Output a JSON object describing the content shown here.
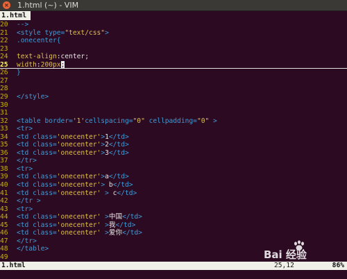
{
  "window": {
    "title": "1.html (~) - VIM",
    "close_glyph": "×"
  },
  "tabline": {
    "active_tab": "1.html"
  },
  "lines": [
    {
      "n": "20",
      "cur": false,
      "parts": [
        {
          "c": "t-comment",
          "t": "-->"
        }
      ]
    },
    {
      "n": "21",
      "cur": false,
      "parts": [
        {
          "c": "t-tag",
          "t": "<style "
        },
        {
          "c": "t-attr",
          "t": "type="
        },
        {
          "c": "t-str",
          "t": "\"text/css\""
        },
        {
          "c": "t-tag",
          "t": ">"
        }
      ]
    },
    {
      "n": "22",
      "cur": false,
      "parts": [
        {
          "c": "t-sel",
          "t": ".onecenter{"
        }
      ]
    },
    {
      "n": "23",
      "cur": false,
      "parts": []
    },
    {
      "n": "24",
      "cur": false,
      "parts": [
        {
          "c": "t-prop",
          "t": "text-align"
        },
        {
          "c": "t-punct",
          "t": ":center;"
        }
      ]
    },
    {
      "n": "25",
      "cur": true,
      "parts": [
        {
          "c": "t-prop",
          "t": "width"
        },
        {
          "c": "t-punct",
          "t": ":"
        },
        {
          "c": "t-prop",
          "t": "200px"
        },
        {
          "c": "t-cursor",
          "t": ";"
        }
      ]
    },
    {
      "n": "26",
      "cur": false,
      "parts": [
        {
          "c": "t-sel",
          "t": "}"
        }
      ]
    },
    {
      "n": "27",
      "cur": false,
      "parts": []
    },
    {
      "n": "28",
      "cur": false,
      "parts": []
    },
    {
      "n": "29",
      "cur": false,
      "parts": [
        {
          "c": "t-tag",
          "t": "</style>"
        }
      ]
    },
    {
      "n": "30",
      "cur": false,
      "parts": []
    },
    {
      "n": "31",
      "cur": false,
      "parts": []
    },
    {
      "n": "32",
      "cur": false,
      "parts": [
        {
          "c": "t-tag",
          "t": "<table "
        },
        {
          "c": "t-attr",
          "t": "border="
        },
        {
          "c": "t-str",
          "t": "'1'"
        },
        {
          "c": "t-attr",
          "t": "cellspacing="
        },
        {
          "c": "t-str",
          "t": "\"0\""
        },
        {
          "c": "t-attr",
          "t": " cellpadding="
        },
        {
          "c": "t-str",
          "t": "\"0\""
        },
        {
          "c": "t-tag",
          "t": " >"
        }
      ]
    },
    {
      "n": "33",
      "cur": false,
      "parts": [
        {
          "c": "t-tag",
          "t": "<tr>"
        }
      ]
    },
    {
      "n": "34",
      "cur": false,
      "parts": [
        {
          "c": "t-tag",
          "t": "<td "
        },
        {
          "c": "t-attr",
          "t": "class="
        },
        {
          "c": "t-str",
          "t": "'onecenter'"
        },
        {
          "c": "t-tag",
          "t": ">"
        },
        {
          "c": "t-text",
          "t": "1"
        },
        {
          "c": "t-tag",
          "t": "</td>"
        }
      ]
    },
    {
      "n": "35",
      "cur": false,
      "parts": [
        {
          "c": "t-tag",
          "t": "<td "
        },
        {
          "c": "t-attr",
          "t": "class="
        },
        {
          "c": "t-str",
          "t": "'onecenter'"
        },
        {
          "c": "t-tag",
          "t": ">"
        },
        {
          "c": "t-text",
          "t": "2"
        },
        {
          "c": "t-tag",
          "t": "</td>"
        }
      ]
    },
    {
      "n": "36",
      "cur": false,
      "parts": [
        {
          "c": "t-tag",
          "t": "<td "
        },
        {
          "c": "t-attr",
          "t": "class="
        },
        {
          "c": "t-str",
          "t": "'onecenter'"
        },
        {
          "c": "t-tag",
          "t": ">"
        },
        {
          "c": "t-text",
          "t": "3"
        },
        {
          "c": "t-tag",
          "t": "</td>"
        }
      ]
    },
    {
      "n": "37",
      "cur": false,
      "parts": [
        {
          "c": "t-tag",
          "t": "</tr>"
        }
      ]
    },
    {
      "n": "38",
      "cur": false,
      "parts": [
        {
          "c": "t-tag",
          "t": "<tr>"
        }
      ]
    },
    {
      "n": "39",
      "cur": false,
      "parts": [
        {
          "c": "t-tag",
          "t": "<td "
        },
        {
          "c": "t-attr",
          "t": "class="
        },
        {
          "c": "t-str",
          "t": "'onecenter'"
        },
        {
          "c": "t-tag",
          "t": ">"
        },
        {
          "c": "t-text",
          "t": "a"
        },
        {
          "c": "t-tag",
          "t": "</td>"
        }
      ]
    },
    {
      "n": "40",
      "cur": false,
      "parts": [
        {
          "c": "t-tag",
          "t": "<td "
        },
        {
          "c": "t-attr",
          "t": "class="
        },
        {
          "c": "t-str",
          "t": "'onecenter'"
        },
        {
          "c": "t-tag",
          "t": ">"
        },
        {
          "c": "t-text",
          "t": " b"
        },
        {
          "c": "t-tag",
          "t": "</td>"
        }
      ]
    },
    {
      "n": "41",
      "cur": false,
      "parts": [
        {
          "c": "t-tag",
          "t": "<td "
        },
        {
          "c": "t-attr",
          "t": "class="
        },
        {
          "c": "t-str",
          "t": "'onecenter'"
        },
        {
          "c": "t-tag",
          "t": " > "
        },
        {
          "c": "t-text",
          "t": "c"
        },
        {
          "c": "t-tag",
          "t": "</td>"
        }
      ]
    },
    {
      "n": "42",
      "cur": false,
      "parts": [
        {
          "c": "t-tag",
          "t": "</tr >"
        }
      ]
    },
    {
      "n": "43",
      "cur": false,
      "parts": [
        {
          "c": "t-tag",
          "t": "<tr>"
        }
      ]
    },
    {
      "n": "44",
      "cur": false,
      "parts": [
        {
          "c": "t-tag",
          "t": "<td "
        },
        {
          "c": "t-attr",
          "t": "class="
        },
        {
          "c": "t-str",
          "t": "'onecenter'"
        },
        {
          "c": "t-tag",
          "t": " >"
        },
        {
          "c": "t-text",
          "t": "中国"
        },
        {
          "c": "t-tag",
          "t": "</td>"
        }
      ]
    },
    {
      "n": "45",
      "cur": false,
      "parts": [
        {
          "c": "t-tag",
          "t": "<td "
        },
        {
          "c": "t-attr",
          "t": "class="
        },
        {
          "c": "t-str",
          "t": "'onecenter'"
        },
        {
          "c": "t-tag",
          "t": " >"
        },
        {
          "c": "t-text",
          "t": "我"
        },
        {
          "c": "t-tag",
          "t": "</td>"
        }
      ]
    },
    {
      "n": "46",
      "cur": false,
      "parts": [
        {
          "c": "t-tag",
          "t": "<td "
        },
        {
          "c": "t-attr",
          "t": "class="
        },
        {
          "c": "t-str",
          "t": "'onecenter'"
        },
        {
          "c": "t-tag",
          "t": " >"
        },
        {
          "c": "t-text",
          "t": "爱你"
        },
        {
          "c": "t-tag",
          "t": "</td>"
        }
      ]
    },
    {
      "n": "47",
      "cur": false,
      "parts": [
        {
          "c": "t-tag",
          "t": "</tr>"
        }
      ]
    },
    {
      "n": "48",
      "cur": false,
      "parts": [
        {
          "c": "t-tag",
          "t": "</table>"
        }
      ]
    },
    {
      "n": "49",
      "cur": false,
      "parts": []
    }
  ],
  "statusline": {
    "filename": "1.html",
    "position": "25,12",
    "percent": "86%"
  },
  "watermark": {
    "text": "Bai 经验"
  },
  "colors": {
    "background": "#2c0a22",
    "line_number": "#c8b400",
    "tag": "#3f9cd8",
    "string": "#e0c14a",
    "statusline_bg": "#f0efe8"
  }
}
